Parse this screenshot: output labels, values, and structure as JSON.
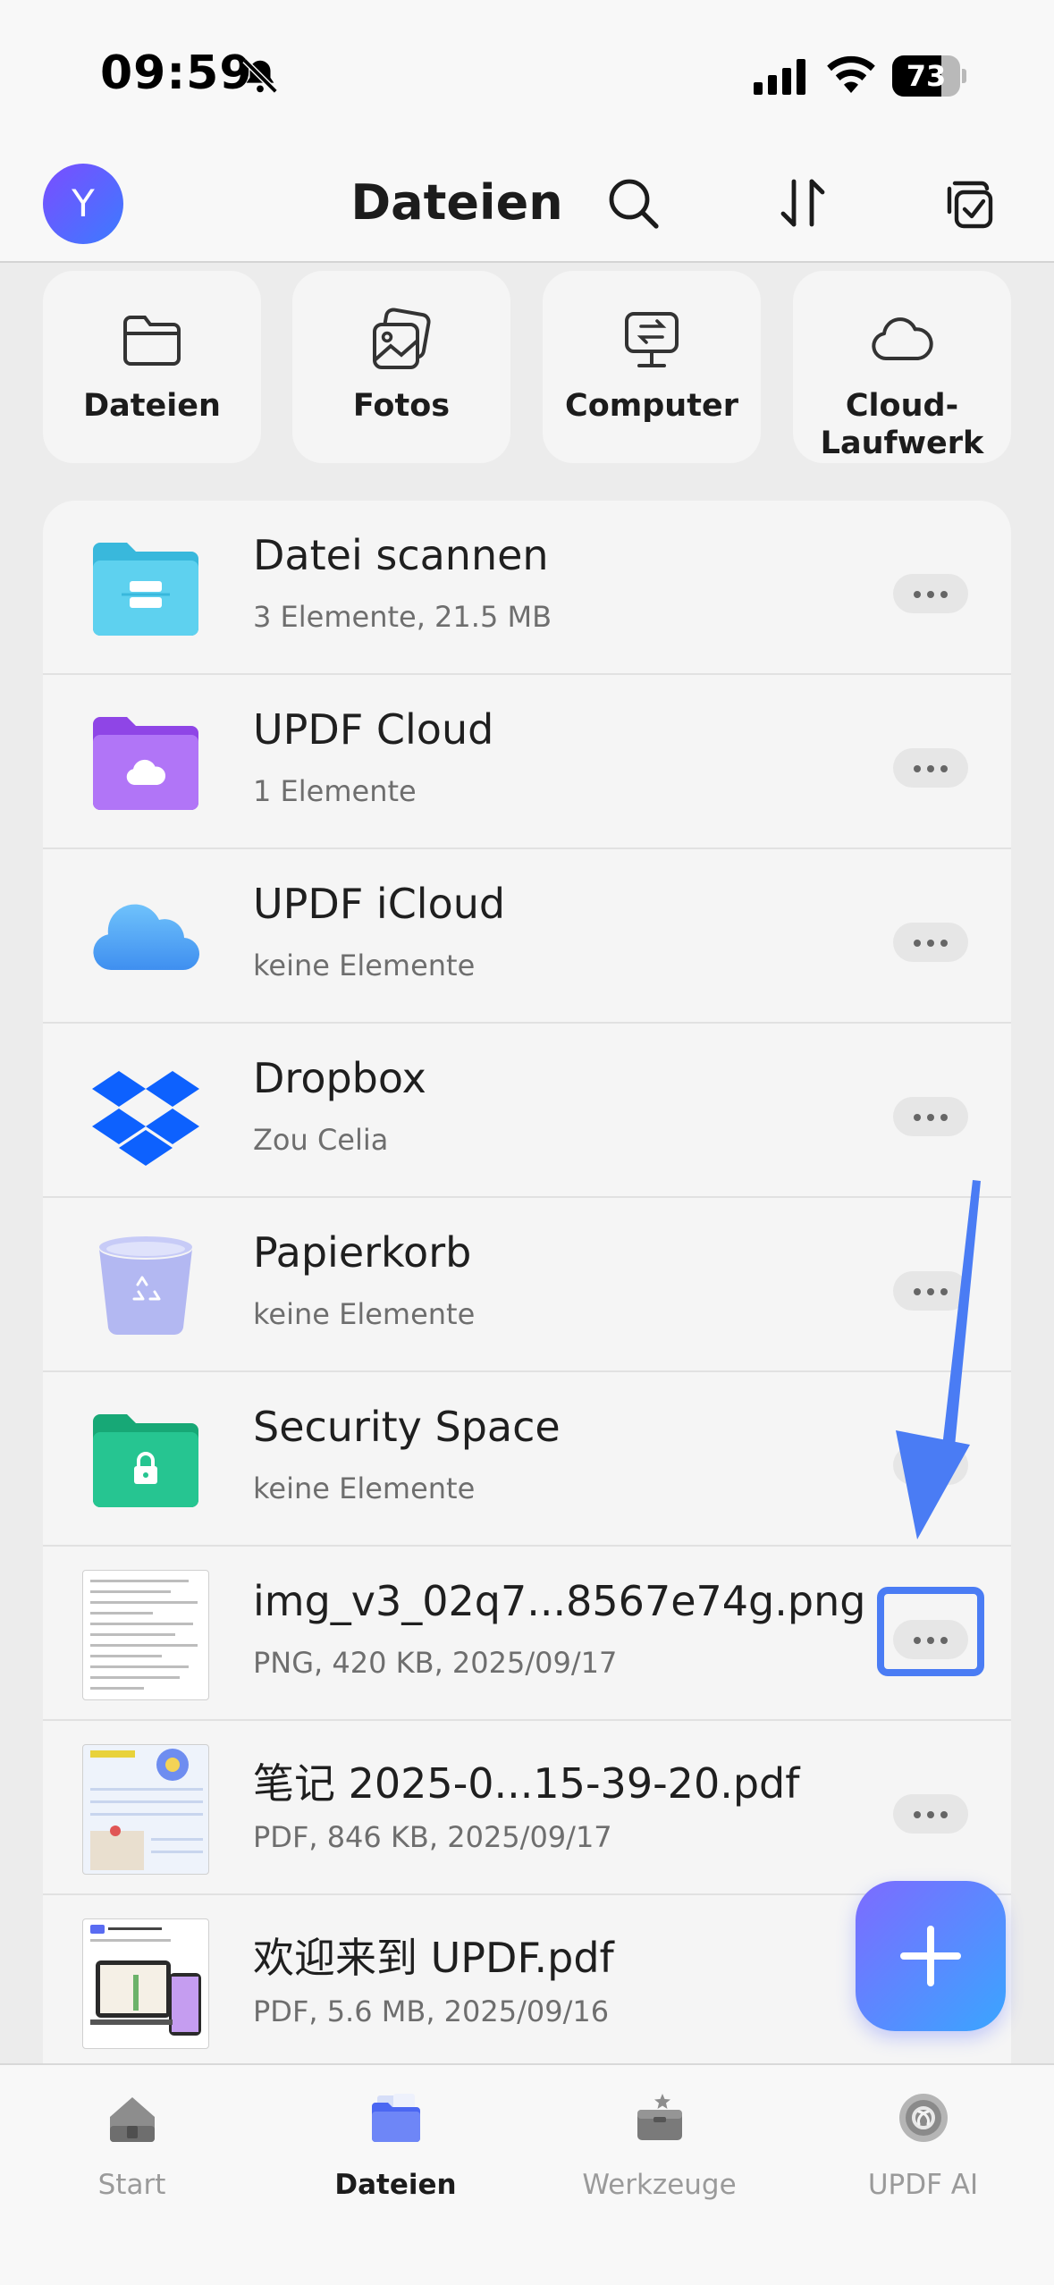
{
  "status_bar": {
    "time": "09:59",
    "battery": "73",
    "battery_level": 0.73,
    "icons": [
      "bell-muted-icon",
      "cellular-signal-icon",
      "wifi-icon",
      "battery-icon"
    ]
  },
  "header": {
    "avatar_letter": "Y",
    "title": "Dateien",
    "icons": [
      "search-icon",
      "sort-icon",
      "select-icon"
    ]
  },
  "quick_access": [
    {
      "label": "Dateien",
      "icon": "folder-icon"
    },
    {
      "label": "Fotos",
      "icon": "photos-icon"
    },
    {
      "label": "Computer",
      "icon": "computer-transfer-icon"
    },
    {
      "label_line1": "Cloud-",
      "label_line2": "Laufwerk",
      "icon": "cloud-icon"
    }
  ],
  "files": [
    {
      "name": "Datei scannen",
      "meta": "3 Elemente, 21.5 MB",
      "icon": "scan-folder-icon",
      "color": "#4fc3e8"
    },
    {
      "name": "UPDF Cloud",
      "meta": "1 Elemente",
      "icon": "cloud-folder-icon",
      "color": "#a463f2"
    },
    {
      "name": "UPDF iCloud",
      "meta": "keine Elemente",
      "icon": "icloud-icon",
      "color": "#5ab0f6"
    },
    {
      "name": "Dropbox",
      "meta": "Zou Celia",
      "icon": "dropbox-icon",
      "color": "#0d61fe"
    },
    {
      "name": "Papierkorb",
      "meta": "keine Elemente",
      "icon": "trash-bin-icon",
      "color": "#b9bff5"
    },
    {
      "name": "Security Space",
      "meta": "keine Elemente",
      "icon": "lock-folder-icon",
      "color": "#1fbf8a"
    },
    {
      "name": "img_v3_02q7...8567e74g.png",
      "meta": "PNG, 420 KB, 2025/09/17",
      "icon": "image-thumbnail-icon"
    },
    {
      "name": " 笔记 2025-0...15-39-20.pdf",
      "meta": "PDF, 846 KB, 2025/09/17",
      "icon": "pdf-thumbnail-icon"
    },
    {
      "name": "欢迎来到 UPDF.pdf",
      "meta": "PDF, 5.6 MB, 2025/09/16",
      "icon": "pdf-thumbnail-icon"
    }
  ],
  "tabs": [
    {
      "label": "Start",
      "icon": "home-icon"
    },
    {
      "label": "Dateien",
      "icon": "files-icon",
      "active": true
    },
    {
      "label": "Werkzeuge",
      "icon": "toolbox-icon"
    },
    {
      "label": "UPDF AI",
      "icon": "ai-icon"
    }
  ],
  "colors": {
    "accent": "#4a7cf4",
    "background": "#ececec",
    "card": "#f5f5f5"
  }
}
